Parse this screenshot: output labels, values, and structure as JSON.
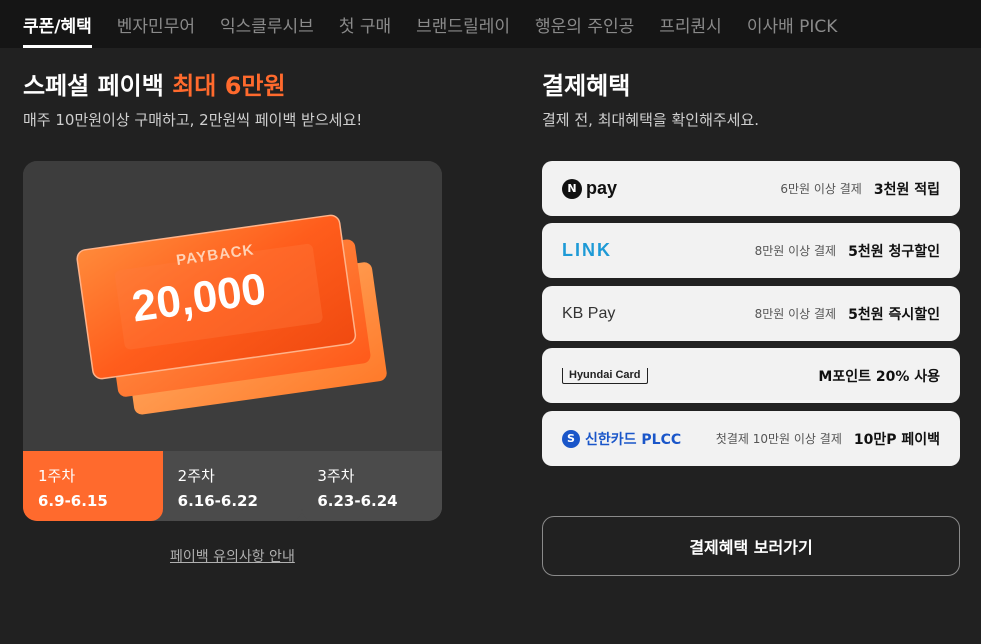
{
  "tabs": [
    "쿠폰/혜택",
    "벤자민무어",
    "익스클루시브",
    "첫 구매",
    "브랜드릴레이",
    "행운의 주인공",
    "프리퀀시",
    "이사배 PICK"
  ],
  "left": {
    "title_prefix": "스페셜 페이백 ",
    "title_highlight": "최대 6만원",
    "subtitle": "매주 10만원이상 구매하고, 2만원씩 페이백 받으세요!",
    "card_small_text": "PAYBACK",
    "card_big_text": "20,000",
    "weeks": [
      {
        "label": "1주차",
        "date": "6.9-6.15"
      },
      {
        "label": "2주차",
        "date": "6.16-6.22"
      },
      {
        "label": "3주차",
        "date": "6.23-6.24"
      }
    ],
    "notice_link": "페이백 유의사항 안내"
  },
  "right": {
    "title": "결제혜택",
    "subtitle": "결제 전, 최대혜택을 확인해주세요.",
    "payments": [
      {
        "logo_mark": "N",
        "logo_text": "pay",
        "condition": "6만원 이상 결제",
        "benefit": "3천원 적립"
      },
      {
        "logo_text": "LINK",
        "condition": "8만원 이상 결제",
        "benefit": "5천원 청구할인"
      },
      {
        "logo_text": "KB Pay",
        "condition": "8만원 이상 결제",
        "benefit": "5천원 즉시할인"
      },
      {
        "logo_text": "Hyundai Card",
        "condition": "",
        "benefit": "M포인트 20% 사용"
      },
      {
        "logo_mark": "S",
        "logo_text": "신한카드 PLCC",
        "condition": "첫결제 10만원 이상 결제",
        "benefit": "10만P 페이백"
      }
    ],
    "cta": "결제혜택 보러가기"
  },
  "colors": {
    "accent": "#ff6a2d",
    "background": "#212121",
    "tabbar": "#151515",
    "link_blue": "#1e9ad6",
    "shinhan_blue": "#1a56c9"
  }
}
